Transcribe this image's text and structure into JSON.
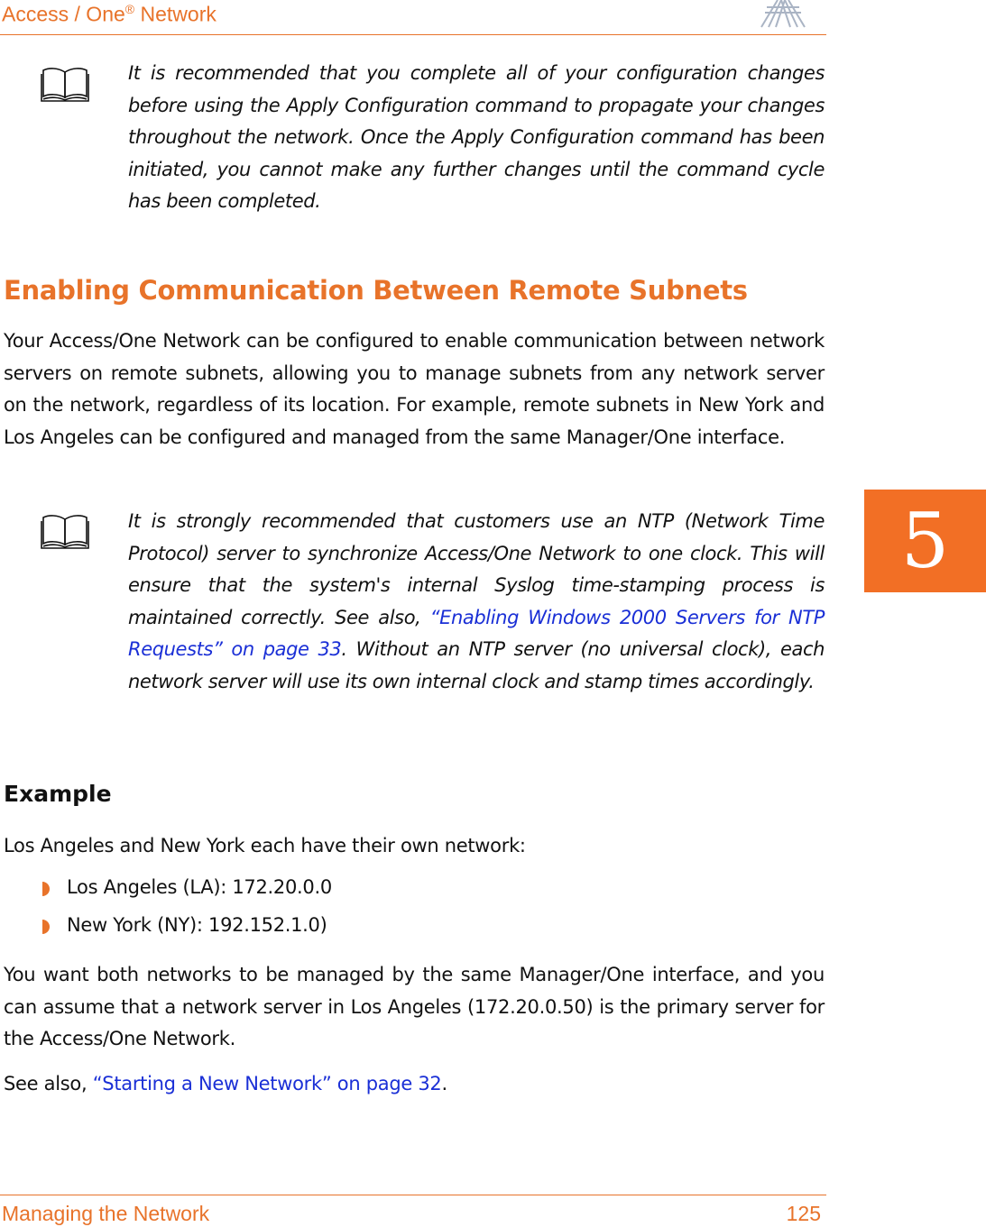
{
  "header": {
    "title": "Access / One",
    "title_sup": "®",
    "title_suffix": " Network"
  },
  "footer": {
    "section": "Managing the Network",
    "page_number": "125"
  },
  "chapter_tab": "5",
  "note1": {
    "icon": "book-icon",
    "text": "It is recommended that you complete all of your configuration changes before using the Apply Configuration command to propagate your changes throughout the network. Once the Apply Configuration command has been initiated, you cannot make any further changes until the command cycle has been completed."
  },
  "heading": "Enabling Communication Between Remote Subnets",
  "intro_paragraph": "Your Access/One Network can be configured to enable communication between network servers on remote subnets, allowing you to manage subnets from any network server on the network, regardless of its location. For example, remote subnets in New York and Los Angeles can be configured and managed from the same Manager/One interface.",
  "note2": {
    "icon": "book-icon",
    "text_before": "It is strongly recommended that customers use an NTP (Network Time Protocol) server to synchronize Access/One Network to one clock. This will ensure that the system's internal Syslog time-stamping process is maintained correctly. See also, ",
    "link": "“Enabling Windows 2000 Servers for NTP Requests” on page 33",
    "text_after": ". Without an NTP server (no universal clock), each network server will use its own internal clock and stamp times accordingly."
  },
  "example": {
    "heading": "Example",
    "lead": "Los Angeles and New York each have their own network:",
    "bullets": [
      "Los Angeles (LA): 172.20.0.0",
      "New York (NY): 192.152.1.0)"
    ],
    "paragraph": "You want both networks to be managed by the same Manager/One interface, and you can assume that a network server in Los Angeles (172.20.0.50) is the primary server for the Access/One Network.",
    "see_also_prefix": "See also, ",
    "see_also_link": "“Starting a New Network” on page 32",
    "see_also_suffix": "."
  }
}
